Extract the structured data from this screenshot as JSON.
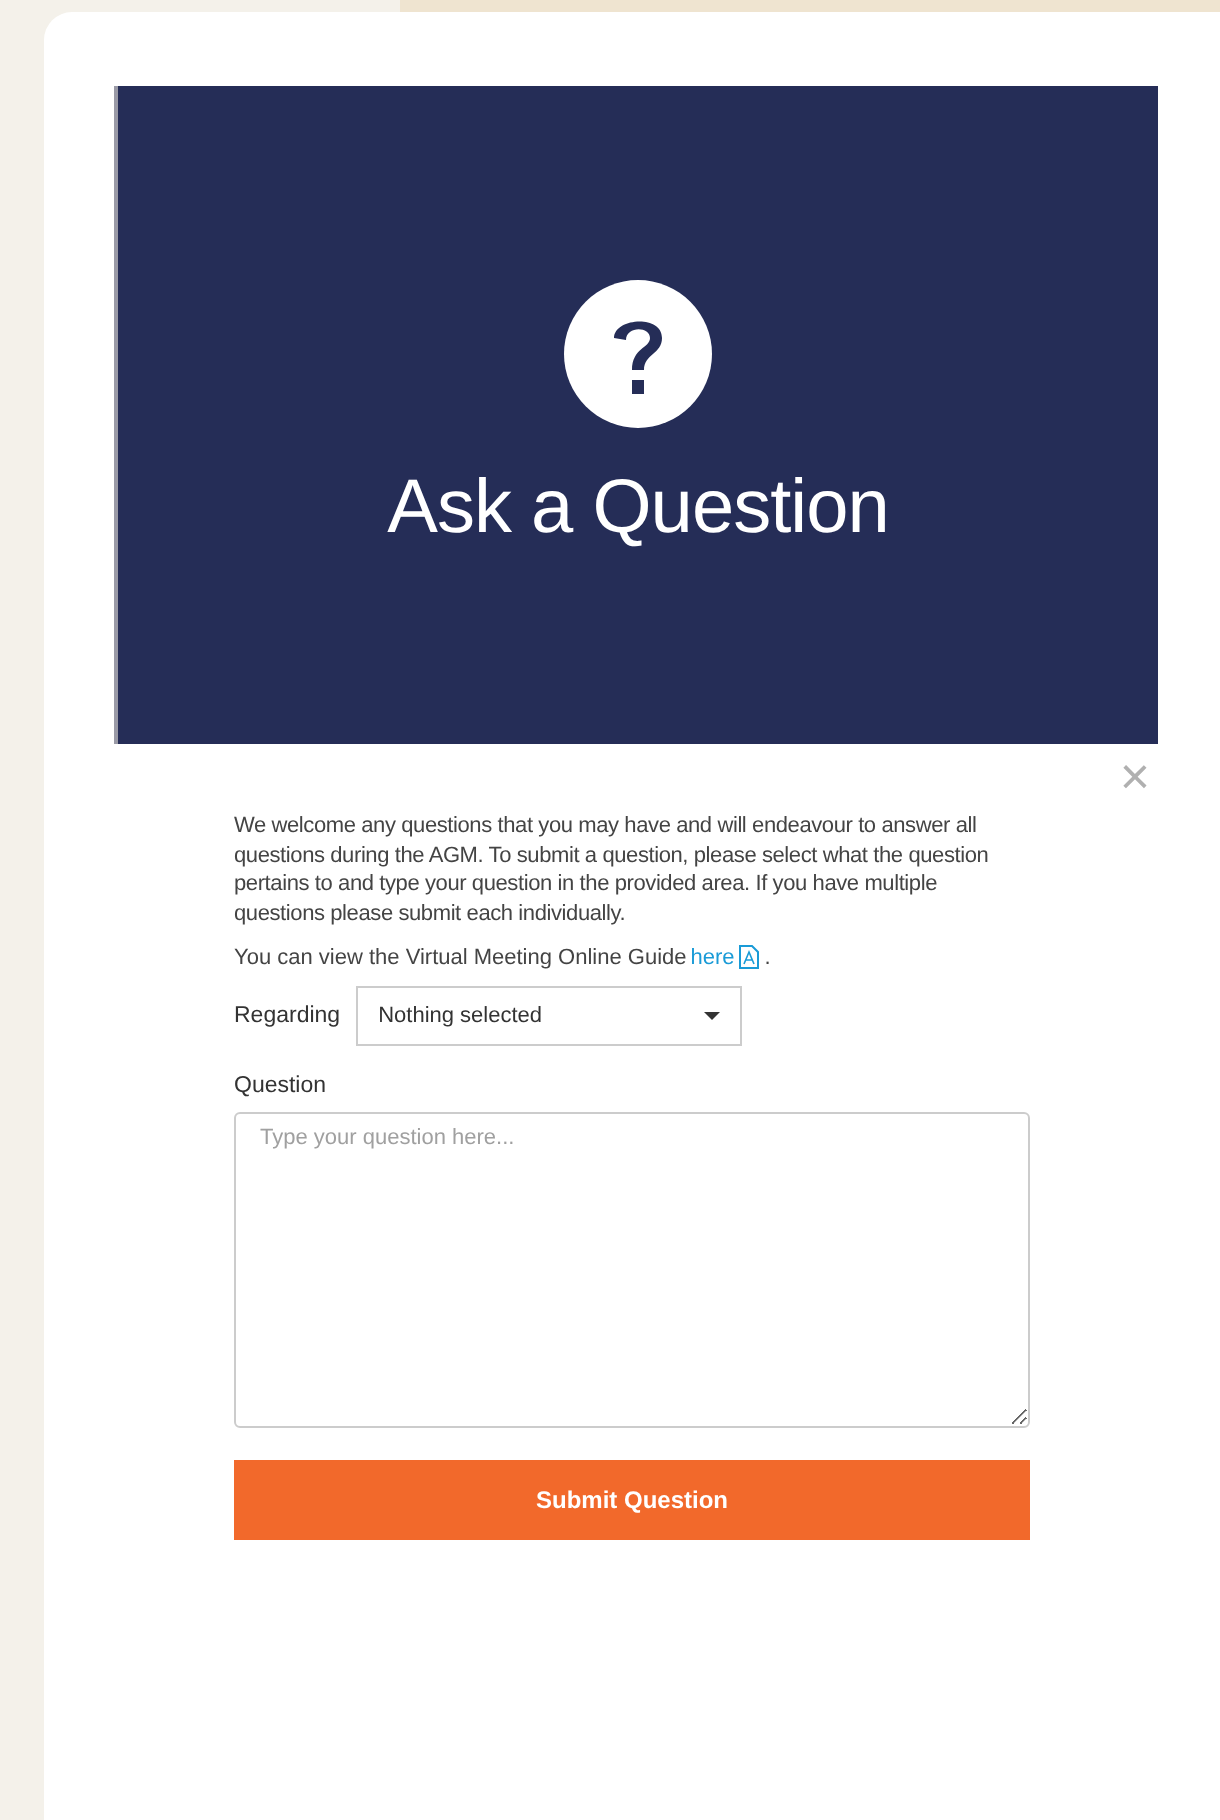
{
  "banner": {
    "title": "Ask a Question"
  },
  "close": {
    "label": "×"
  },
  "intro": "We welcome any questions that you may have and will endeavour to answer all questions during the AGM. To submit a question, please select what the question pertains to and type your question in the provided area. If you have multiple questions please submit each individually.",
  "guide": {
    "text": "You can view the Virtual Meeting Online Guide",
    "link": "here",
    "after": "."
  },
  "regarding": {
    "label": "Regarding",
    "value": "Nothing selected"
  },
  "question": {
    "label": "Question",
    "placeholder": "Type your question here..."
  },
  "submit": {
    "label": "Submit Question"
  }
}
